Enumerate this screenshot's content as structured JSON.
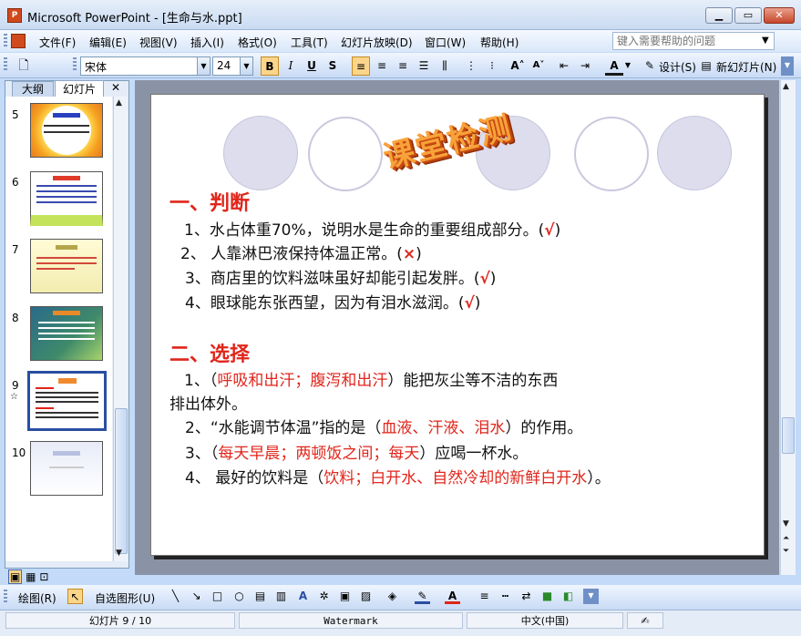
{
  "window": {
    "title": "Microsoft PowerPoint - [生命与水.ppt]",
    "app_icon": "powerpoint-icon"
  },
  "menu": [
    "文件(F)",
    "编辑(E)",
    "视图(V)",
    "插入(I)",
    "格式(O)",
    "工具(T)",
    "幻灯片放映(D)",
    "窗口(W)",
    "帮助(H)"
  ],
  "help_placeholder": "键入需要帮助的问题",
  "toolbar": {
    "font": "宋体",
    "size": "24",
    "bold": "B",
    "italic": "I",
    "underline": "U",
    "shadow": "S",
    "design": "设计(S)",
    "new_slide": "新幻灯片(N)"
  },
  "panel_tabs": {
    "outline": "大纲",
    "slides": "幻灯片"
  },
  "slide_numbers": [
    "5",
    "6",
    "7",
    "8",
    "9",
    "10"
  ],
  "selected_slide": "9",
  "slide": {
    "wordart": "课堂检测",
    "sec1": "一、判断",
    "q1": "1、水占体重70%，说明水是生命的重要组成部分。(",
    "q1_mark": "√",
    "q2": "2、 人靠淋巴液保持体温正常。(",
    "q2_mark": "×",
    "q3": "3、商店里的饮料滋味虽好却能引起发胖。(",
    "q3_mark": "√",
    "q4": "4、眼球能东张西望，因为有泪水滋润。(",
    "q4_mark": "√",
    "close": ")",
    "sec2": "二、选择",
    "c1_pre": "1、（",
    "c1_ans": "呼吸和出汗；腹泻和出汗",
    "c1_post": "）能把灰尘等不洁的东西",
    "c1_line2": "排出体外。",
    "c2_pre": "2、“水能调节体温”指的是（",
    "c2_ans": "血液、汗液、泪水",
    "c2_post": "）的作用。",
    "c3_pre": "3、（",
    "c3_ans": "每天早晨；两顿饭之间；每天",
    "c3_post": "）应喝一杯水。",
    "c4_pre": "4、 最好的饮料是（",
    "c4_ans": "饮料；白开水、自然冷却的新鲜白开水",
    "c4_post": "）。"
  },
  "drawing_toolbar": {
    "draw": "绘图(R)",
    "autoshapes": "自选图形(U)"
  },
  "status": {
    "slide": "幻灯片 9 / 10",
    "design": "Watermark",
    "lang": "中文(中国)"
  }
}
